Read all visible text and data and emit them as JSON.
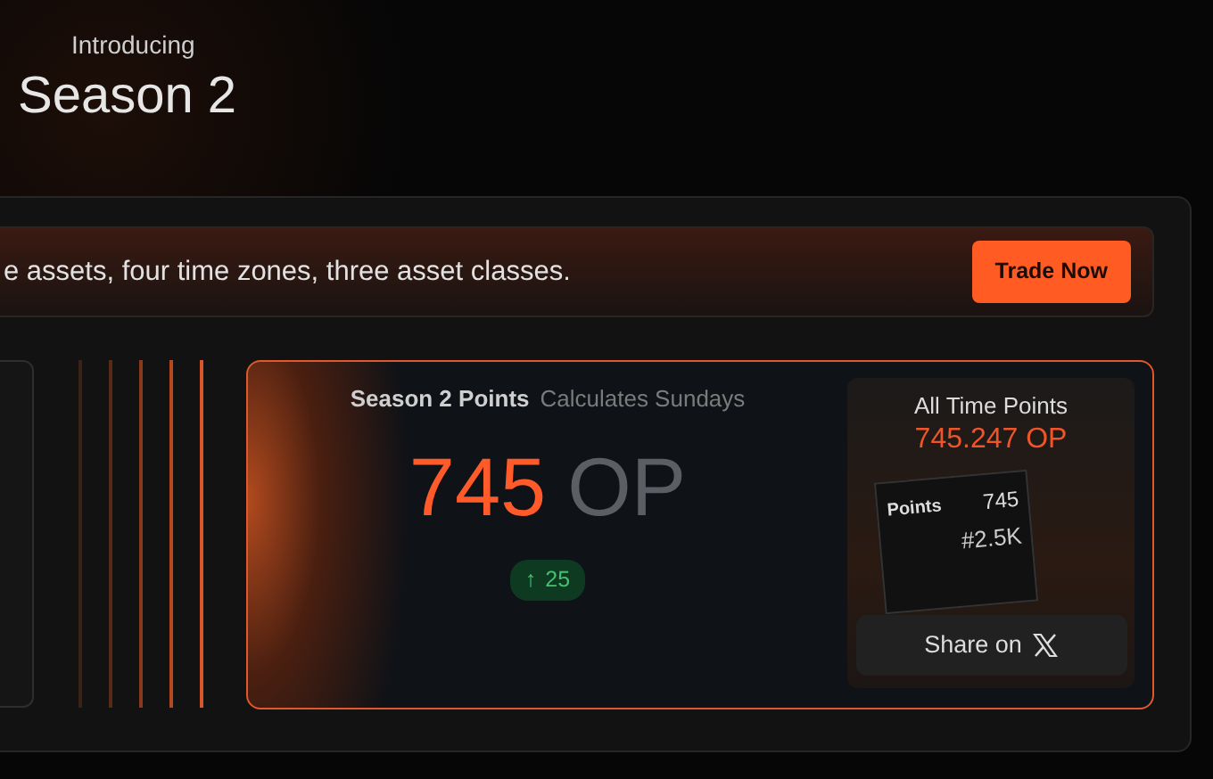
{
  "header": {
    "eyebrow": "Introducing",
    "title": "Season 2"
  },
  "banner": {
    "text": "e assets, four time zones, three asset classes.",
    "button": "Trade Now"
  },
  "points_card": {
    "title": "Season 2 Points",
    "subtitle": "Calculates Sundays",
    "value": "745",
    "unit": "OP",
    "change": {
      "arrow": "↑",
      "text": "25"
    }
  },
  "all_time": {
    "title": "All Time Points",
    "value": "745.247 OP",
    "preview": {
      "label": "Points",
      "value": "745",
      "rank": "#2.5K"
    },
    "share_button": "Share on"
  }
}
